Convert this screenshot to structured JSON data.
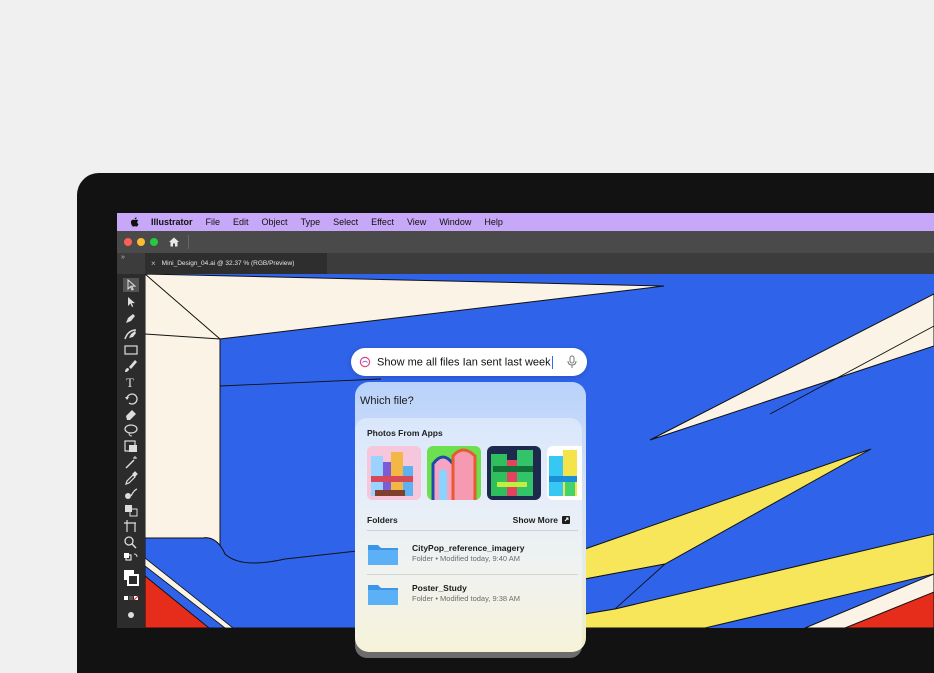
{
  "menubar": {
    "app_name": "Illustrator",
    "items": [
      "File",
      "Edit",
      "Object",
      "Type",
      "Select",
      "Effect",
      "View",
      "Window",
      "Help"
    ]
  },
  "document_tab": {
    "close_glyph": "×",
    "title": "Mini_Design_04.ai @ 32.37 % (RGB/Preview)"
  },
  "search": {
    "query": "Show me all files Ian sent last week"
  },
  "results": {
    "prompt": "Which file?",
    "photos_heading": "Photos From Apps",
    "folders_heading": "Folders",
    "show_more_label": "Show More",
    "folders": [
      {
        "name": "CityPop_reference_imagery",
        "detail": "Folder • Modified today, 9:40 AM"
      },
      {
        "name": "Poster_Study",
        "detail": "Folder • Modified today, 9:38 AM"
      }
    ]
  },
  "colors": {
    "menubar": "#c7a7f7",
    "canvas_blue": "#2f63ea",
    "canvas_cream": "#fbf4e6",
    "canvas_yellow": "#f8e65a",
    "canvas_red": "#e62d1c",
    "folder_blue": "#4fa9f5",
    "accent": "#2a6bff"
  },
  "icons": {
    "menubar": "apple-logo",
    "window": [
      "home-icon"
    ],
    "search": [
      "search-sparkle-icon",
      "microphone-icon"
    ],
    "results": [
      "external-link-icon",
      "folder-icon"
    ]
  }
}
